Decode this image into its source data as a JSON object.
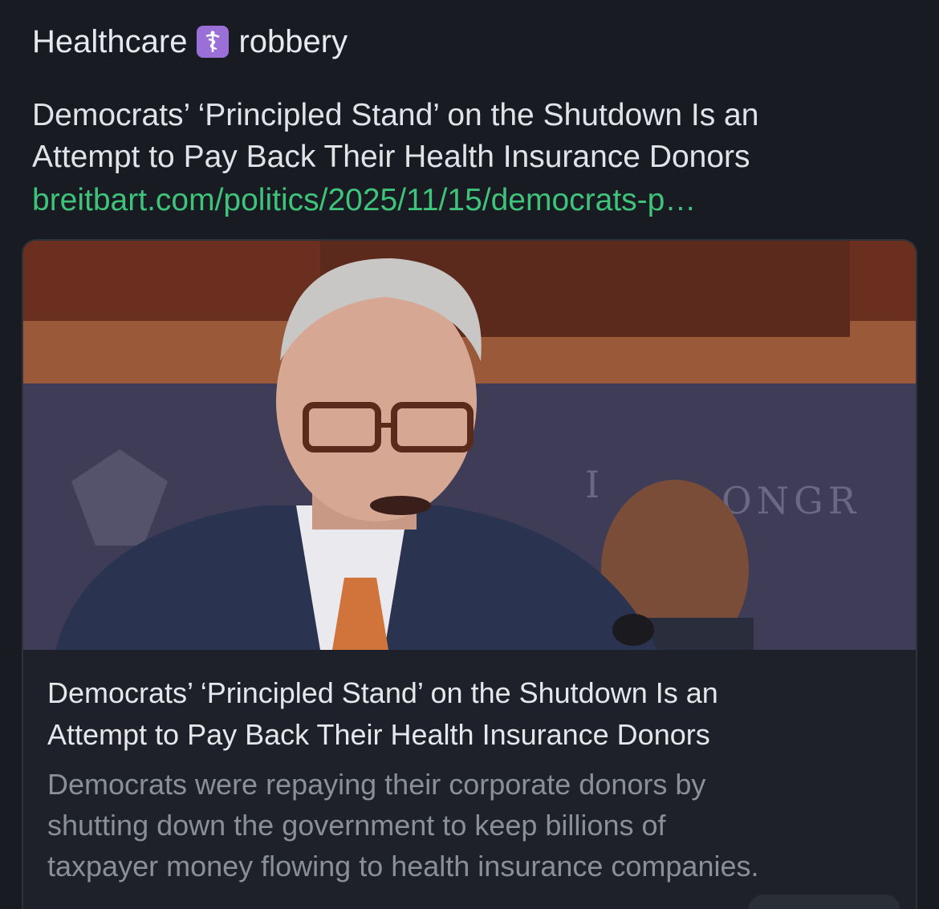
{
  "post": {
    "text_before_emoji": "Healthcare",
    "emoji_icon": "medical-symbol-icon",
    "text_after_emoji": "robbery",
    "headline_line1": "Democrats’ ‘Principled Stand’ on the Shutdown Is an",
    "headline_line2": "Attempt to Pay Back Their Health Insurance Donors",
    "link_text": "breitbart.com/politics/2025/11/15/democrats-p…"
  },
  "link_card": {
    "image_alt": "photo of speaker at lectern",
    "title_line1": "Democrats’ ‘Principled Stand’ on the Shutdown Is an",
    "title_line2": "Attempt to Pay Back Their Health Insurance Donors",
    "desc_line1": "Democrats were repaying their corporate donors by",
    "desc_line2": "shutting down the government to keep billions of",
    "desc_line3": "taxpayer money flowing to health insurance companies."
  },
  "colors": {
    "background": "#181b22",
    "link": "#3fc37a",
    "emoji_badge": "#9a6fd8",
    "card_border": "#2e323b",
    "desc_text": "#8b8f98"
  }
}
